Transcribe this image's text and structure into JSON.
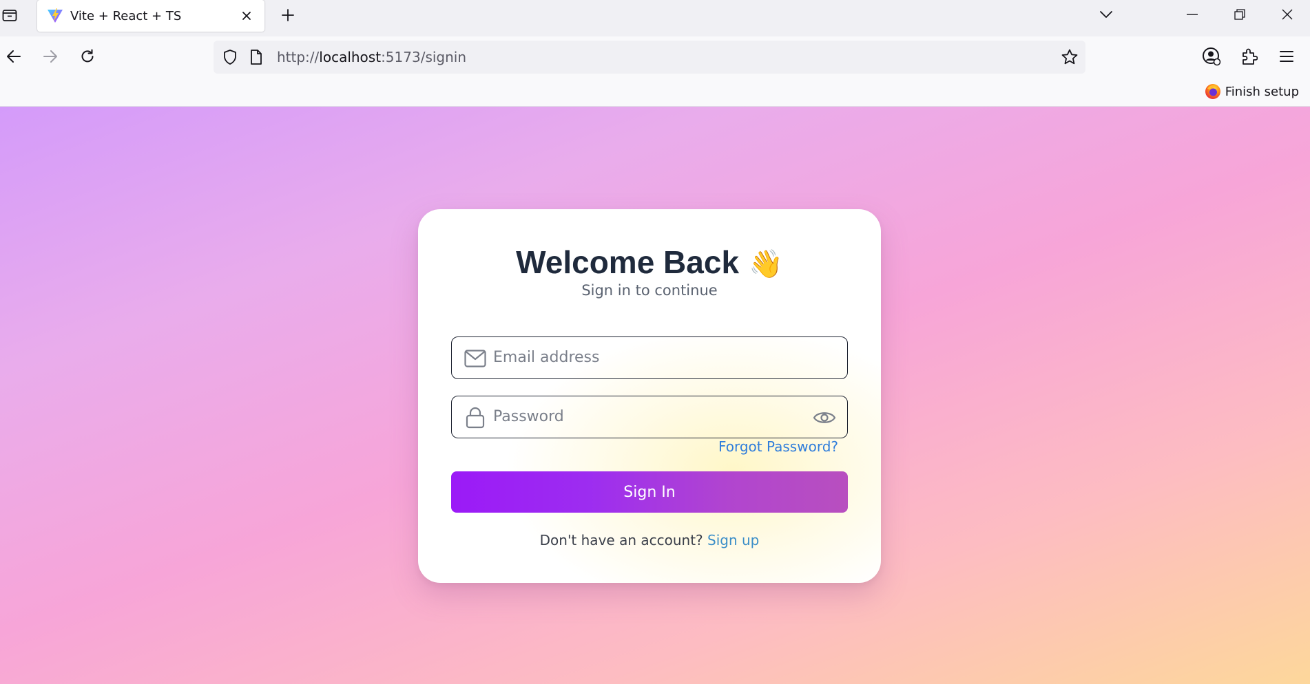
{
  "browser": {
    "tab": {
      "title": "Vite + React + TS"
    },
    "url": {
      "scheme": "http://",
      "host": "localhost",
      "rest": ":5173/signin"
    },
    "finish_setup_label": "Finish setup"
  },
  "signin": {
    "title": "Welcome Back",
    "title_emoji": "👋",
    "subtitle": "Sign in to continue",
    "email_placeholder": "Email address",
    "password_placeholder": "Password",
    "forgot_label": "Forgot Password?",
    "submit_label": "Sign In",
    "signup_prompt": "Don't have an account?",
    "signup_link": "Sign up"
  },
  "colors": {
    "primary_gradient_start": "#9b1af7",
    "primary_gradient_end": "#b84fbf",
    "link": "#2f7ddb",
    "title": "#1f2a3c"
  },
  "icons": {
    "tab_list": "tab-list-icon",
    "favicon": "vite-logo-icon",
    "tab_close": "close-icon",
    "new_tab": "plus-icon",
    "tabs_menu": "chevron-down-icon",
    "back": "arrow-left-icon",
    "forward": "arrow-right-icon",
    "reload": "reload-icon",
    "tracking": "shield-icon",
    "page_info": "page-icon",
    "bookmark": "star-icon",
    "account": "account-icon",
    "extensions": "puzzle-icon",
    "app_menu": "hamburger-icon",
    "email": "mail-icon",
    "password": "lock-icon",
    "show_password": "eye-icon"
  }
}
